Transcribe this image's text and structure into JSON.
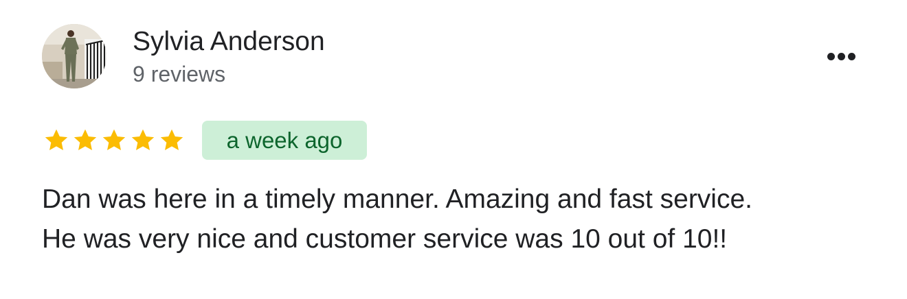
{
  "review": {
    "author": {
      "name": "Sylvia Anderson",
      "review_count": "9 reviews",
      "avatar": "profile-photo"
    },
    "menu_icon": "more-horizontal-icon",
    "rating": {
      "stars": 5,
      "max": 5,
      "star_color": "#fbbc04"
    },
    "time_ago": "a week ago",
    "time_badge_colors": {
      "background": "#cdefd7",
      "text": "#0d652d"
    },
    "text_lines": [
      "Dan was here in a timely manner. Amazing and fast service.",
      "He was very nice and customer service was 10 out of 10!!"
    ]
  }
}
